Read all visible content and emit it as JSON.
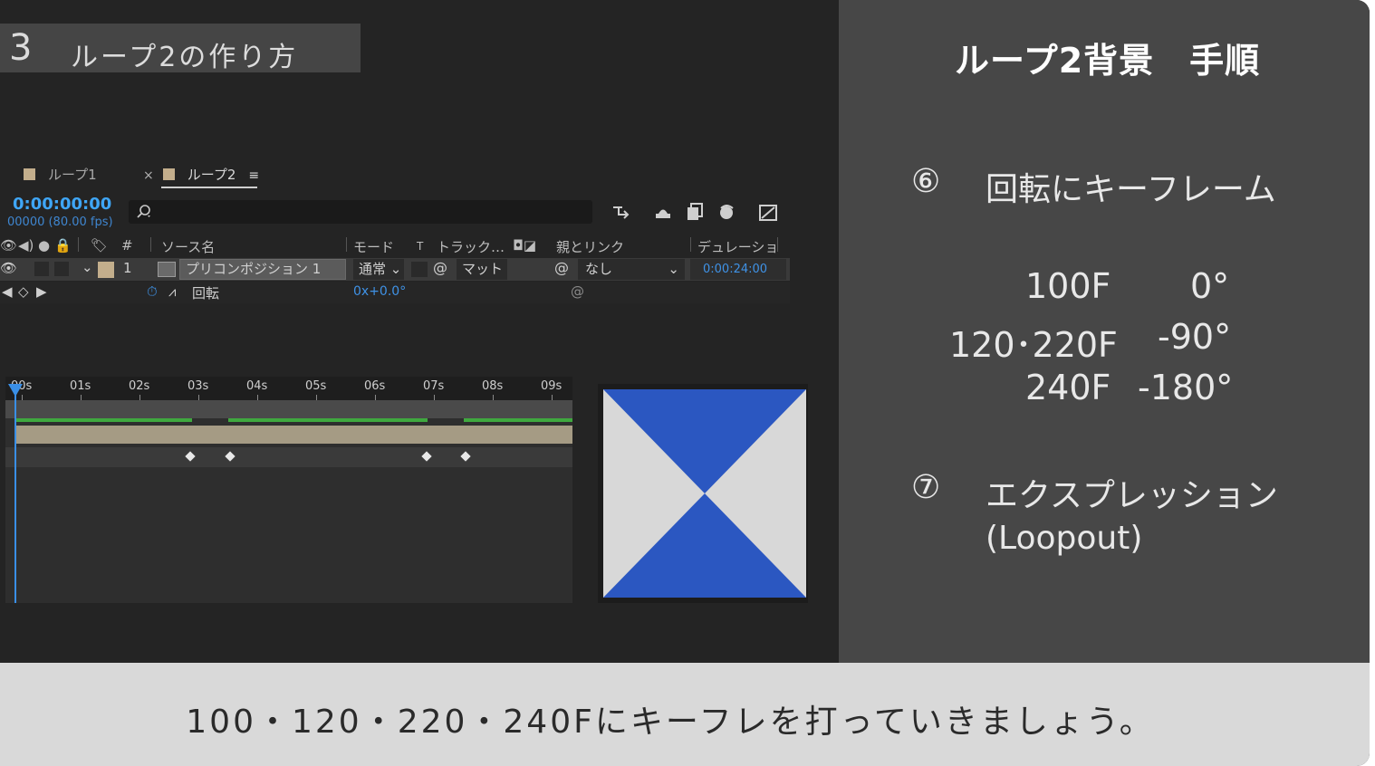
{
  "heading": {
    "number": "3",
    "text": "ループ2の作り方"
  },
  "ae": {
    "tabs": [
      {
        "label": "ループ1"
      },
      {
        "label": "ループ2",
        "close": "×",
        "menu": "≡"
      }
    ],
    "timecode": "0:00:00:00",
    "fps": "00000 (80.00 fps)",
    "columns": {
      "number": "#",
      "source_name": "ソース名",
      "mode": "モード",
      "t": "T",
      "track": "トラック…",
      "parent": "親とリンク",
      "duration": "デュレーション"
    },
    "layer": {
      "index": "1",
      "name": "プリコンポジション 1",
      "mode": "通常",
      "track": "マット",
      "parent": "なし",
      "duration": "0:00:24:00"
    },
    "property": {
      "name": "回転",
      "value": "0x+0.0°"
    },
    "ruler_labels": [
      "00s",
      "01s",
      "02s",
      "03s",
      "04s",
      "05s",
      "06s",
      "07s",
      "08s",
      "09s"
    ]
  },
  "right": {
    "title": "ループ2背景　手順",
    "step6": {
      "num": "⑥",
      "text": "回転にキーフレーム"
    },
    "keyframes": [
      {
        "frame": "100F",
        "angle": "0°"
      },
      {
        "frame": "120･220F",
        "angle": "-90°"
      },
      {
        "frame": "240F",
        "angle": "-180°"
      }
    ],
    "step7": {
      "num": "⑦",
      "text": "エクスプレッション",
      "sub": "(Loopout)"
    }
  },
  "subtitle": "100・120・220・240Fにキーフレを打っていきましょう。",
  "colors": {
    "accent_blue": "#3a8fe6",
    "preview_blue": "#2b57c1",
    "preview_white": "#d8d8d8",
    "green_bar": "#3fa83f"
  }
}
